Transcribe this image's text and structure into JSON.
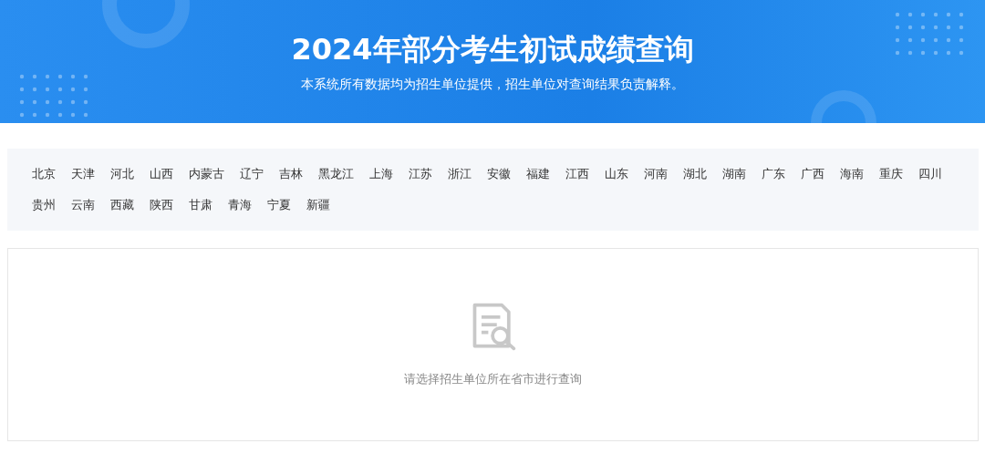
{
  "header": {
    "title": "2024年部分考生初试成绩查询",
    "subtitle": "本系统所有数据均为招生单位提供，招生单位对查询结果负责解释。"
  },
  "provinces": [
    {
      "label": "北京",
      "selected": false
    },
    {
      "label": "天津",
      "selected": false
    },
    {
      "label": "河北",
      "selected": false
    },
    {
      "label": "山西",
      "selected": false
    },
    {
      "label": "内蒙古",
      "selected": false
    },
    {
      "label": "辽宁",
      "selected": false
    },
    {
      "label": "吉林",
      "selected": false
    },
    {
      "label": "黑龙江",
      "selected": false
    },
    {
      "label": "上海",
      "selected": false
    },
    {
      "label": "江苏",
      "selected": false
    },
    {
      "label": "浙江",
      "selected": false
    },
    {
      "label": "安徽",
      "selected": false
    },
    {
      "label": "福建",
      "selected": false
    },
    {
      "label": "江西",
      "selected": false
    },
    {
      "label": "山东",
      "selected": false
    },
    {
      "label": "河南",
      "selected": false
    },
    {
      "label": "湖北",
      "selected": false
    },
    {
      "label": "湖南",
      "selected": false
    },
    {
      "label": "广东",
      "selected": false
    },
    {
      "label": "广西",
      "selected": false
    },
    {
      "label": "海南",
      "selected": false
    },
    {
      "label": "重庆",
      "selected": false
    },
    {
      "label": "四川",
      "selected": false
    },
    {
      "label": "贵州",
      "selected": false
    },
    {
      "label": "云南",
      "selected": false
    },
    {
      "label": "西藏",
      "selected": false
    },
    {
      "label": "陕西",
      "selected": false
    },
    {
      "label": "甘肃",
      "selected": false
    },
    {
      "label": "青海",
      "selected": false
    },
    {
      "label": "宁夏",
      "selected": false
    },
    {
      "label": "新疆",
      "selected": false
    }
  ],
  "empty_state": {
    "message": "请选择招生单位所在省市进行查询"
  }
}
